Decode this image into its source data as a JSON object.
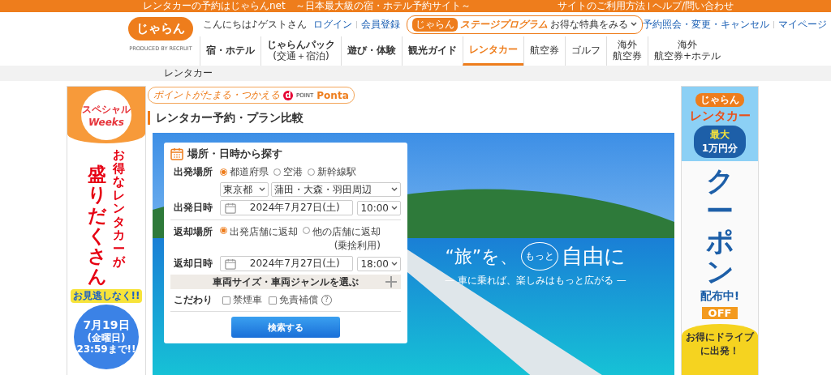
{
  "top_bar": {
    "tagline": "レンタカーの予約はじゃらんnet　～日本最大級の宿・ホテル予約サイト～",
    "links": [
      "サイトのご利用方法",
      "ヘルプ/問い合わせ"
    ]
  },
  "header": {
    "logo": "じゃらん",
    "produced_by": "PRODUCED BY RECRUIT",
    "greeting": "こんにちは♪ゲストさん",
    "auth_links": [
      "ログイン",
      "会員登録"
    ],
    "stage_program": {
      "logo": "じゃらん",
      "label": "ステージプログラム",
      "link": "お得な特典をみる"
    },
    "account_links": [
      "予約照会・変更・キャンセル",
      "マイページ"
    ]
  },
  "nav": [
    {
      "lines": [
        "宿・ホテル"
      ],
      "selected": false,
      "kind": "primary"
    },
    {
      "lines": [
        "じゃらんパック",
        "(交通＋宿泊)"
      ],
      "selected": false,
      "kind": "primary"
    },
    {
      "lines": [
        "遊び・体験"
      ],
      "selected": false,
      "kind": "primary"
    },
    {
      "lines": [
        "観光ガイド"
      ],
      "selected": false,
      "kind": "primary"
    },
    {
      "lines": [
        "レンタカー"
      ],
      "selected": true,
      "kind": "primary"
    },
    {
      "lines": [
        "航空券"
      ],
      "selected": false,
      "kind": "secondary"
    },
    {
      "lines": [
        "ゴルフ"
      ],
      "selected": false,
      "kind": "secondary"
    },
    {
      "lines": [
        "海外",
        "航空券"
      ],
      "selected": false,
      "kind": "secondary"
    },
    {
      "lines": [
        "海外",
        "航空券+ホテル"
      ],
      "selected": false,
      "kind": "secondary"
    }
  ],
  "breadcrumb": [
    "レンタカー"
  ],
  "points_badge": {
    "text": "ポイントがたまる・つかえる",
    "d_mark": "d",
    "brands": [
      "POINT",
      "Ponta"
    ]
  },
  "page_title": "レンタカー予約・プラン比較",
  "hero": {
    "slogan_before": "“旅”を、",
    "slogan_circle": "もっと",
    "slogan_after": "自由に",
    "subtitle": "— 車に乗れば、楽しみはもっと広がる —"
  },
  "search_form": {
    "title": "場所・日時から探す",
    "departure_place": {
      "label": "出発場所",
      "options": [
        {
          "label": "都道府県",
          "selected": true
        },
        {
          "label": "空港",
          "selected": false
        },
        {
          "label": "新幹線駅",
          "selected": false
        }
      ],
      "prefecture": "東京都",
      "area": "蒲田・大森・羽田周辺"
    },
    "departure_time": {
      "label": "出発日時",
      "date": "2024年7月27日(土)",
      "time": "10:00"
    },
    "return_place": {
      "label": "返却場所",
      "options": [
        {
          "label": "出発店舗に返却",
          "selected": true
        },
        {
          "label": "他の店舗に返却",
          "note": "(乗捨利用)",
          "selected": false
        }
      ]
    },
    "return_time": {
      "label": "返却日時",
      "date": "2024年7月27日(土)",
      "time": "18:00"
    },
    "vehicle_section": {
      "label": "車両サイズ・車両ジャンルを選ぶ",
      "expanded": false
    },
    "preferences": {
      "label": "こだわり",
      "options": [
        {
          "label": "禁煙車",
          "checked": false
        },
        {
          "label": "免責補償",
          "checked": false,
          "help": "?"
        }
      ]
    },
    "submit": "検索する"
  },
  "left_banner": {
    "logo_top": "スペシャル",
    "logo_bottom": "Weeks",
    "column_right": "お得なレンタカーが",
    "column_left": "盛りだくさん",
    "ribbon": "お見逃しなく!!",
    "date": "7月19日",
    "weekday": "(金曜日)",
    "deadline": "23:59まで!!"
  },
  "right_banner": {
    "logo": "じゃらん",
    "title": "レンタカー",
    "cloud_top": "最大",
    "cloud_amount": "1万円分",
    "coupon": "クーポン",
    "distributing": "配布中!",
    "tag": "OFF",
    "bottom": "お得にドライブに出発！"
  }
}
